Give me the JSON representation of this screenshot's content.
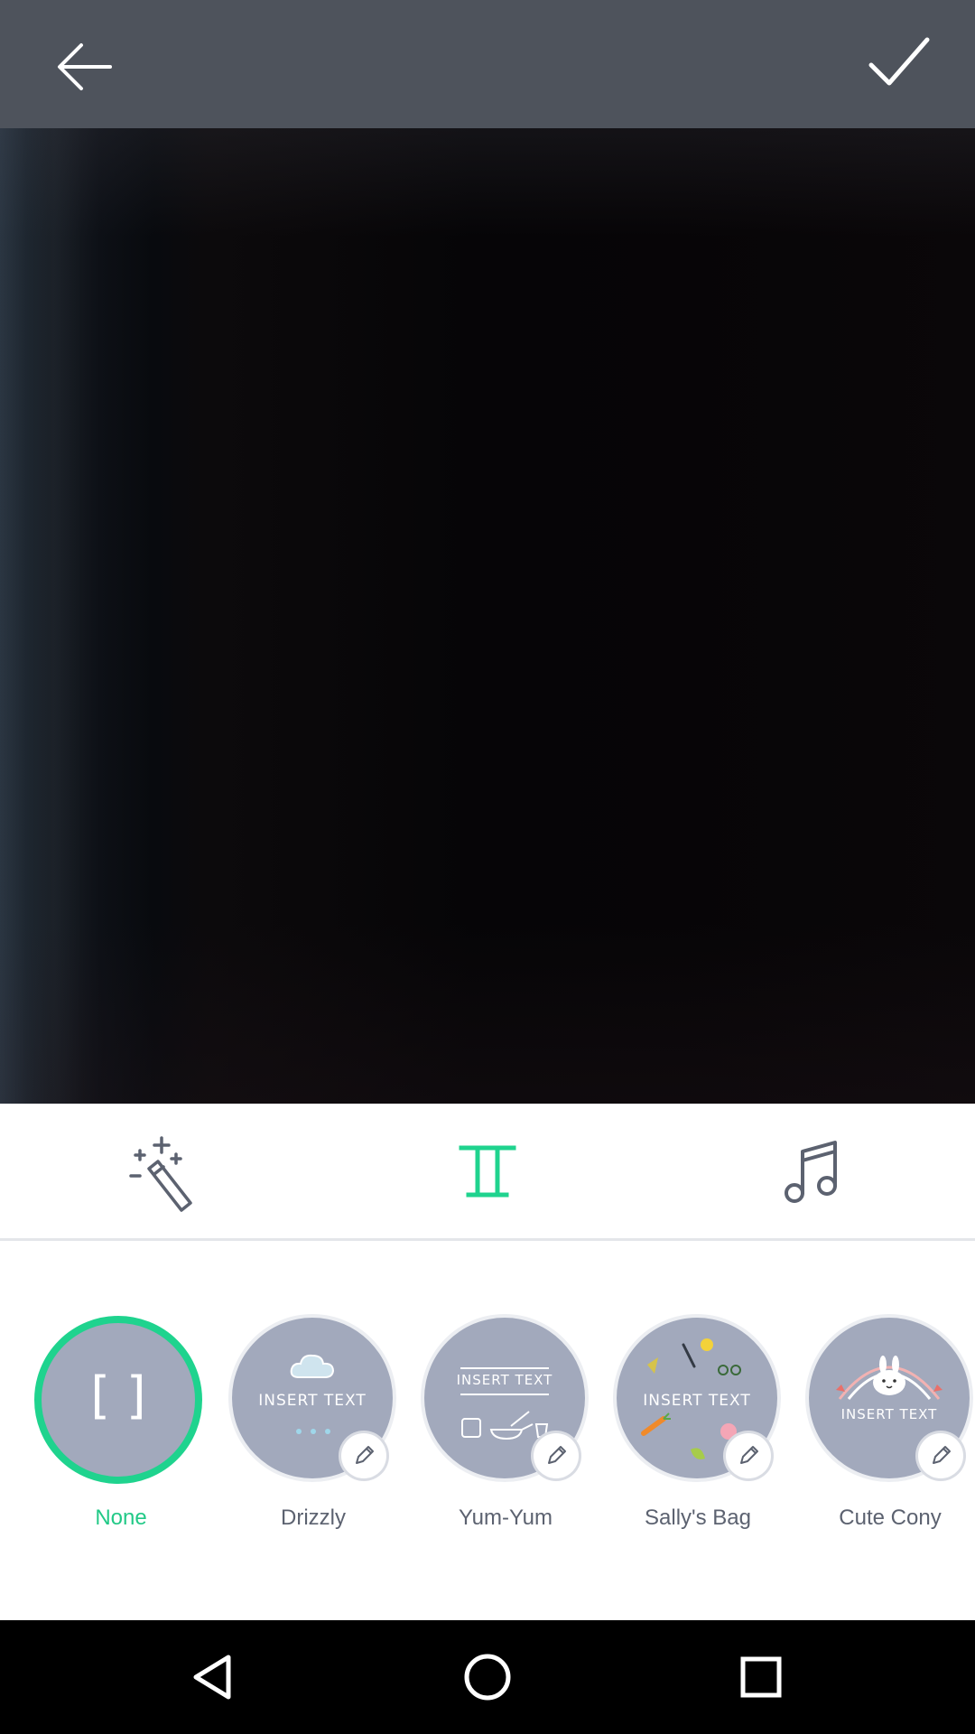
{
  "topbar": {
    "back_icon": "arrow-left-icon",
    "done_icon": "check-icon",
    "background": "#4e535c"
  },
  "tools": [
    {
      "name": "effects",
      "icon": "magic-wand-icon"
    },
    {
      "name": "text",
      "icon": "text-icon",
      "color": "#1fd38e"
    },
    {
      "name": "music",
      "icon": "music-note-icon"
    }
  ],
  "templates": [
    {
      "label": "None",
      "selected": true,
      "circle_text": "[  ]"
    },
    {
      "label": "Drizzly",
      "selected": false,
      "circle_text": "INSERT TEXT"
    },
    {
      "label": "Yum-Yum",
      "selected": false,
      "circle_text": "INSERT TEXT"
    },
    {
      "label": "Sally's Bag",
      "selected": false,
      "circle_text": "INSERT TEXT"
    },
    {
      "label": "Cute Cony",
      "selected": false,
      "circle_text": "INSERT TEXT"
    }
  ],
  "colors": {
    "accent": "#1fd38e",
    "template_circle": "#a2a9bc",
    "icon_gray": "#5c6270"
  },
  "navbar": {
    "icons": [
      "back-triangle-icon",
      "home-circle-icon",
      "recents-square-icon"
    ]
  }
}
